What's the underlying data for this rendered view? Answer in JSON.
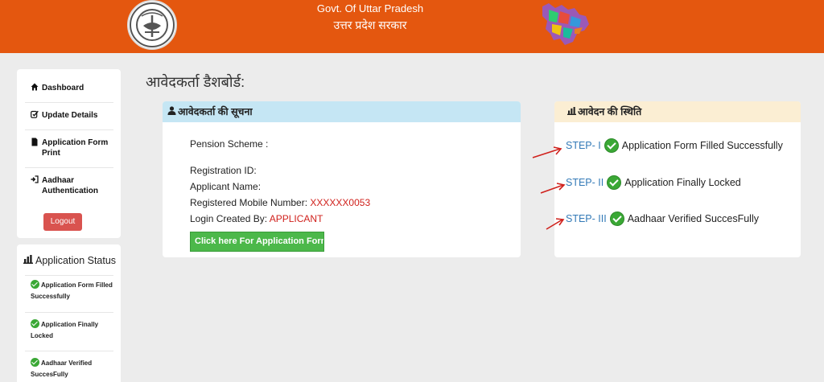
{
  "header": {
    "title_en": "Govt. Of Uttar Pradesh",
    "title_hi": "उत्तर प्रदेश सरकार",
    "emblem_icon": "up-government-emblem-icon",
    "map_icon": "uttar-pradesh-map-icon",
    "bg_color": "#e4570f"
  },
  "sidebar": {
    "items": [
      {
        "icon": "home-icon",
        "label": "Dashboard"
      },
      {
        "icon": "edit-icon",
        "label": "Update Details"
      },
      {
        "icon": "document-icon",
        "label": "Application Form Print"
      },
      {
        "icon": "sign-in-icon",
        "label": "Aadhaar Authentication"
      }
    ],
    "logout_label": "Logout"
  },
  "status_sidebar": {
    "title": "Application Status",
    "items": [
      "Application Form Filled Successfully",
      "Application Finally Locked",
      "Aadhaar Verified SuccesFully"
    ]
  },
  "main": {
    "title": "आवेदकर्ता डैशबोर्ड:",
    "info_card": {
      "title": "आवेदकर्ता की सूचना",
      "pension_label": "Pension Scheme :",
      "registration_label": "Registration ID:",
      "name_label": "Applicant Name:",
      "mobile_label": "Registered Mobile Number:",
      "mobile_value": "XXXXXX0053",
      "login_label": "Login Created By:",
      "login_value": "APPLICANT",
      "button_label": "Click here For Application Form"
    },
    "status_card": {
      "title": "आवेदन की स्थिति",
      "steps": [
        {
          "step": "STEP- I",
          "text": "Application Form Filled Successfully"
        },
        {
          "step": "STEP- II",
          "text": "Application Finally Locked"
        },
        {
          "step": "STEP- III",
          "text": "Aadhaar Verified SuccesFully"
        }
      ]
    }
  },
  "colors": {
    "accent_red": "#d0211c",
    "step_blue": "#337ab7",
    "check_green": "#3aa835",
    "logout_red": "#d9534f",
    "button_green": "#4cb84a"
  }
}
